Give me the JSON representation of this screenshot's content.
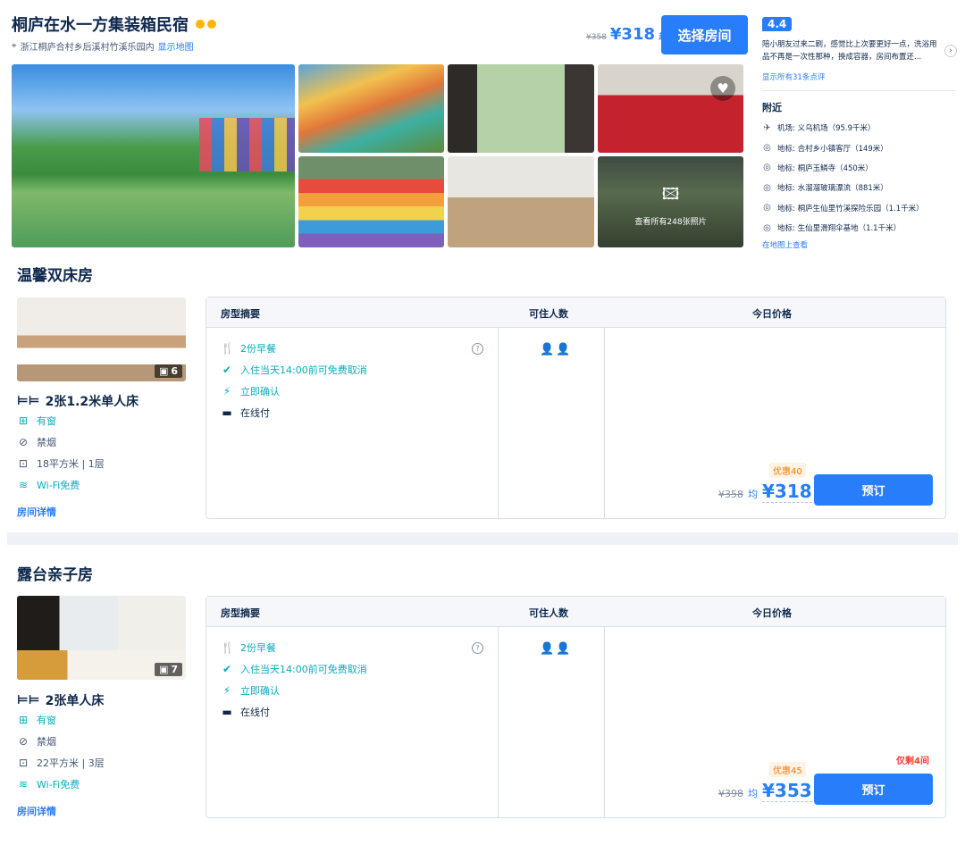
{
  "hotel": {
    "name": "桐庐在水一方集装箱民宿",
    "address": "浙江桐庐合村乡后溪村竹溪乐园内",
    "show_map": "显示地图",
    "old_price": "¥358",
    "price": "¥318",
    "price_suffix": "起",
    "select_room": "选择房间"
  },
  "gallery": {
    "view_all": "查看所有248张照片"
  },
  "review": {
    "score": "4.4",
    "text": "陪小朋友过来二刷，感觉比上次要更好一点，洗浴用品不再是一次性那种，换成容器，房间布置还...",
    "show_all": "显示所有31条点评"
  },
  "nearby": {
    "title": "附近",
    "items": [
      {
        "icon": "plane-icon",
        "text": "机场: 义乌机场（95.9千米）"
      },
      {
        "icon": "location-icon",
        "text": "地标: 合村乡小镇客厅（149米）"
      },
      {
        "icon": "location-icon",
        "text": "地标: 桐庐玉鳞寺（450米）"
      },
      {
        "icon": "location-icon",
        "text": "地标: 水溜溜玻璃漂流（881米）"
      },
      {
        "icon": "location-icon",
        "text": "地标: 桐庐生仙里竹溪探险乐园（1.1千米）"
      },
      {
        "icon": "location-icon",
        "text": "地标: 生仙里滑翔伞基地（1.1千米）"
      }
    ],
    "map_link": "在地图上查看"
  },
  "table_headers": {
    "summary": "房型摘要",
    "guests": "可住人数",
    "price": "今日价格"
  },
  "rooms": [
    {
      "name": "温馨双床房",
      "photo_count": "6",
      "bed": "2张1.2米单人床",
      "window": "有窗",
      "smoking": "禁烟",
      "area": "18平方米 | 1层",
      "wifi": "Wi-Fi免费",
      "details": "房间详情",
      "perks": [
        "2份早餐",
        "入住当天14:00前可免费取消",
        "立即确认",
        "在线付"
      ],
      "discount": "优惠40",
      "old_price": "¥358",
      "avg": "均",
      "price": "¥318",
      "book": "预订",
      "only_left": ""
    },
    {
      "name": "露台亲子房",
      "photo_count": "7",
      "bed": "2张单人床",
      "window": "有窗",
      "smoking": "禁烟",
      "area": "22平方米 | 3层",
      "wifi": "Wi-Fi免费",
      "details": "房间详情",
      "perks": [
        "2份早餐",
        "入住当天14:00前可免费取消",
        "立即确认",
        "在线付"
      ],
      "discount": "优惠45",
      "old_price": "¥398",
      "avg": "均",
      "price": "¥353",
      "book": "预订",
      "only_left": "仅剩4间"
    }
  ],
  "colors": {
    "accent": "#287dfa",
    "benefit": "#06aebd",
    "discount": "#ff7700",
    "alert": "#ff3b30"
  }
}
